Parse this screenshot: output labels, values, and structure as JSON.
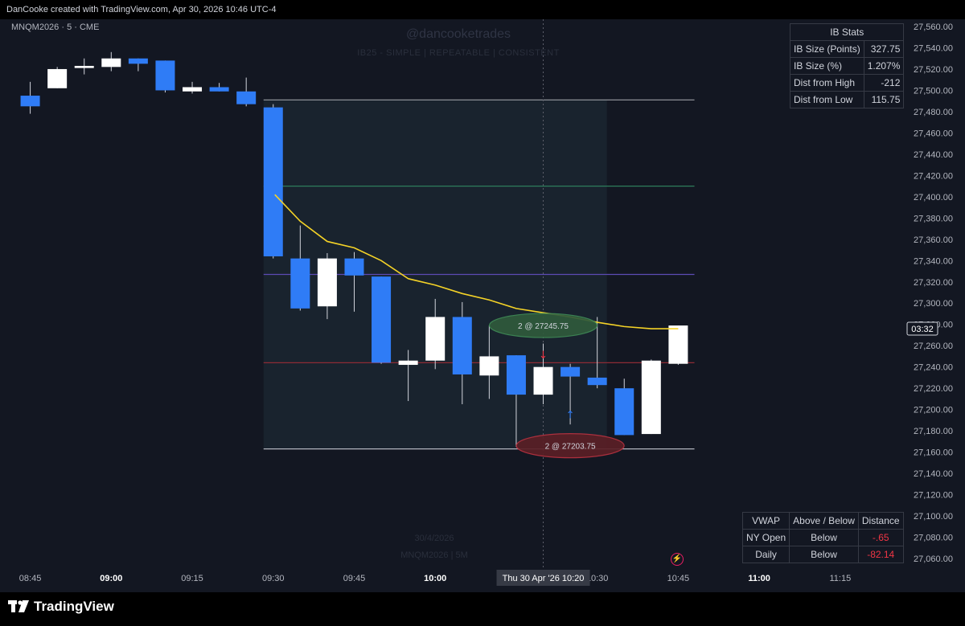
{
  "header": {
    "credit": "DanCooke created with TradingView.com, Apr 30, 2026 10:46 UTC-4"
  },
  "symbol": "MNQM2026 · 5 · CME",
  "watermark": {
    "handle": "@dancooketrades",
    "tagline": "IB25  -  SIMPLE  |  REPEATABLE  |  CONSISTENT",
    "date": "30/4/2026",
    "instrument": "MNQM2026 | 5M"
  },
  "ib_stats": {
    "title": "IB Stats",
    "rows": [
      {
        "label": "IB Size (Points)",
        "value": "327.75"
      },
      {
        "label": "IB Size (%)",
        "value": "1.207%"
      },
      {
        "label": "Dist from High",
        "value": "-212"
      },
      {
        "label": "Dist from Low",
        "value": "115.75"
      }
    ]
  },
  "vwap_table": {
    "headers": [
      "VWAP",
      "Above / Below",
      "Distance"
    ],
    "rows": [
      {
        "label": "NY Open",
        "position": "Below",
        "distance": "-.65"
      },
      {
        "label": "Daily",
        "position": "Below",
        "distance": "-82.14"
      }
    ]
  },
  "brand": "TradingView",
  "chart_data": {
    "type": "candlestick",
    "timeframe": "5m",
    "y_ticks": [
      "27,560.00",
      "27,540.00",
      "27,520.00",
      "27,500.00",
      "27,480.00",
      "27,460.00",
      "27,440.00",
      "27,420.00",
      "27,400.00",
      "27,380.00",
      "27,360.00",
      "27,340.00",
      "27,320.00",
      "27,300.00",
      "27,280.00",
      "27,260.00",
      "27,240.00",
      "27,220.00",
      "27,200.00",
      "27,180.00",
      "27,160.00",
      "27,140.00",
      "27,120.00",
      "27,100.00",
      "27,080.00",
      "27,060.00"
    ],
    "y_tick_values": [
      27560,
      27540,
      27520,
      27500,
      27480,
      27460,
      27440,
      27420,
      27400,
      27380,
      27360,
      27340,
      27320,
      27300,
      27280,
      27260,
      27240,
      27220,
      27200,
      27180,
      27160,
      27140,
      27120,
      27100,
      27080,
      27060
    ],
    "ylim": [
      27045,
      27570
    ],
    "x_ticks": [
      {
        "label": "08:45",
        "time": "08:45",
        "bold": false
      },
      {
        "label": "09:00",
        "time": "09:00",
        "bold": true
      },
      {
        "label": "09:15",
        "time": "09:15",
        "bold": false
      },
      {
        "label": "09:30",
        "time": "09:30",
        "bold": false
      },
      {
        "label": "09:45",
        "time": "09:45",
        "bold": false
      },
      {
        "label": "10:00",
        "time": "10:00",
        "bold": true
      },
      {
        "label": "10:30",
        "time": "10:30",
        "bold": false
      },
      {
        "label": "10:45",
        "time": "10:45",
        "bold": false
      },
      {
        "label": "11:00",
        "time": "11:00",
        "bold": true
      },
      {
        "label": "11:15",
        "time": "11:15",
        "bold": false
      }
    ],
    "x_range": [
      "08:40",
      "11:25"
    ],
    "crosshair": {
      "time": "10:20",
      "label": "Thu 30 Apr '26   10:20"
    },
    "countdown": {
      "label": "03:32",
      "price": 27276
    },
    "candles": [
      {
        "t": "08:45",
        "o": 27495,
        "h": 27508,
        "l": 27478,
        "c": 27485
      },
      {
        "t": "08:50",
        "o": 27502,
        "h": 27522,
        "l": 27502,
        "c": 27520
      },
      {
        "t": "08:55",
        "o": 27521,
        "h": 27530,
        "l": 27515,
        "c": 27523
      },
      {
        "t": "09:00",
        "o": 27522,
        "h": 27536,
        "l": 27518,
        "c": 27530
      },
      {
        "t": "09:05",
        "o": 27530,
        "h": 27530,
        "l": 27518,
        "c": 27525
      },
      {
        "t": "09:10",
        "o": 27528,
        "h": 27528,
        "l": 27498,
        "c": 27500
      },
      {
        "t": "09:15",
        "o": 27499,
        "h": 27508,
        "l": 27497,
        "c": 27503
      },
      {
        "t": "09:20",
        "o": 27503,
        "h": 27507,
        "l": 27499,
        "c": 27499
      },
      {
        "t": "09:25",
        "o": 27499,
        "h": 27512,
        "l": 27485,
        "c": 27487
      },
      {
        "t": "09:30",
        "o": 27484,
        "h": 27487,
        "l": 27342,
        "c": 27344
      },
      {
        "t": "09:35",
        "o": 27342,
        "h": 27373,
        "l": 27293,
        "c": 27295
      },
      {
        "t": "09:40",
        "o": 27297,
        "h": 27347,
        "l": 27285,
        "c": 27342
      },
      {
        "t": "09:45",
        "o": 27342,
        "h": 27348,
        "l": 27292,
        "c": 27326
      },
      {
        "t": "09:50",
        "o": 27325,
        "h": 27325,
        "l": 27243,
        "c": 27244
      },
      {
        "t": "09:55",
        "o": 27242,
        "h": 27256,
        "l": 27208,
        "c": 27246
      },
      {
        "t": "10:00",
        "o": 27246,
        "h": 27304,
        "l": 27238,
        "c": 27287
      },
      {
        "t": "10:05",
        "o": 27287,
        "h": 27301,
        "l": 27205,
        "c": 27233
      },
      {
        "t": "10:10",
        "o": 27232,
        "h": 27279,
        "l": 27210,
        "c": 27250
      },
      {
        "t": "10:15",
        "o": 27251,
        "h": 27251,
        "l": 27165,
        "c": 27214
      },
      {
        "t": "10:20",
        "o": 27214,
        "h": 27262,
        "l": 27205,
        "c": 27240
      },
      {
        "t": "10:25",
        "o": 27240,
        "h": 27243,
        "l": 27186,
        "c": 27231
      },
      {
        "t": "10:30",
        "o": 27230,
        "h": 27287,
        "l": 27220,
        "c": 27223
      },
      {
        "t": "10:35",
        "o": 27220,
        "h": 27229,
        "l": 27176,
        "c": 27176
      },
      {
        "t": "10:40",
        "o": 27177,
        "h": 27247,
        "l": 27177,
        "c": 27246
      },
      {
        "t": "10:45",
        "o": 27243,
        "h": 27279,
        "l": 27242,
        "c": 27279
      }
    ],
    "vwap_line": [
      {
        "t": "09:30",
        "v": 27402
      },
      {
        "t": "09:35",
        "v": 27377
      },
      {
        "t": "09:40",
        "v": 27358
      },
      {
        "t": "09:45",
        "v": 27352
      },
      {
        "t": "09:50",
        "v": 27340
      },
      {
        "t": "09:55",
        "v": 27323
      },
      {
        "t": "10:00",
        "v": 27317
      },
      {
        "t": "10:05",
        "v": 27309
      },
      {
        "t": "10:10",
        "v": 27303
      },
      {
        "t": "10:15",
        "v": 27295
      },
      {
        "t": "10:20",
        "v": 27291
      },
      {
        "t": "10:25",
        "v": 27287
      },
      {
        "t": "10:30",
        "v": 27282
      },
      {
        "t": "10:35",
        "v": 27278
      },
      {
        "t": "10:40",
        "v": 27276
      },
      {
        "t": "10:45",
        "v": 27276
      }
    ],
    "levels": [
      {
        "price": 27491,
        "color": "#8c8f96",
        "from": "09:30",
        "to": "10:48"
      },
      {
        "price": 27410,
        "color": "#2e7d5b",
        "from": "09:30",
        "to": "10:48"
      },
      {
        "price": 27327,
        "color": "#5c4bb5",
        "from": "09:30",
        "to": "10:48"
      },
      {
        "price": 27244,
        "color": "#8e2b35",
        "from": "09:30",
        "to": "10:48"
      },
      {
        "price": 27163,
        "color": "#b2b5be",
        "from": "09:30",
        "to": "10:48"
      }
    ],
    "ib_zone": {
      "from": "09:30",
      "to": "10:30",
      "high": 27491,
      "low": 27163
    },
    "trades": [
      {
        "label": "2 @ 27245.75",
        "price": 27245.75,
        "time": "10:20",
        "side": "sell",
        "bubble_price": 27279
      },
      {
        "label": "2 @ 27203.75",
        "price": 27203.75,
        "time": "10:25",
        "side": "buy",
        "bubble_price": 27166
      }
    ],
    "colors": {
      "up": "#ffffff",
      "down": "#2f7cf6",
      "wick": "#d1d4dc",
      "vwap": "#f5d327",
      "negative": "#f23645"
    }
  }
}
